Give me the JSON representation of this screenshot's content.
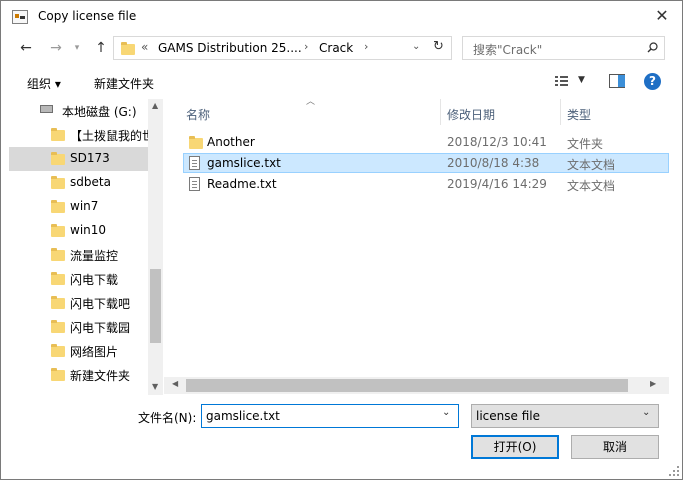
{
  "window": {
    "title": "Copy license file"
  },
  "nav": {
    "path": [
      "GAMS Distribution 25....",
      "Crack"
    ],
    "search_placeholder": "搜索\"Crack\""
  },
  "toolbar": {
    "organize": "组织 ▾",
    "new_folder": "新建文件夹"
  },
  "sidebar": {
    "drive": "本地磁盘 (G:)",
    "items": [
      {
        "label": "【土拨鼠我的世"
      },
      {
        "label": "SD173"
      },
      {
        "label": "sdbeta"
      },
      {
        "label": "win7"
      },
      {
        "label": "win10"
      },
      {
        "label": "流量监控"
      },
      {
        "label": "闪电下载"
      },
      {
        "label": "闪电下载吧"
      },
      {
        "label": "闪电下载园"
      },
      {
        "label": "网络图片"
      },
      {
        "label": "新建文件夹"
      }
    ]
  },
  "columns": {
    "name": "名称",
    "date": "修改日期",
    "type": "类型"
  },
  "files": [
    {
      "name": "Another",
      "date": "2018/12/3 10:41",
      "type": "文件夹",
      "icon": "folder-icon"
    },
    {
      "name": "gamslice.txt",
      "date": "2010/8/18 4:38",
      "type": "文本文档",
      "icon": "text-file-icon"
    },
    {
      "name": "Readme.txt",
      "date": "2019/4/16 14:29",
      "type": "文本文档",
      "icon": "text-file-icon"
    }
  ],
  "footer": {
    "filename_label": "文件名(N):",
    "filename_value": "gamslice.txt",
    "filter_value": "license file",
    "open_label": "打开(O)",
    "cancel_label": "取消"
  },
  "colors": {
    "accent": "#0078d7",
    "selection": "#cce8ff",
    "folder": "#f8d775"
  }
}
